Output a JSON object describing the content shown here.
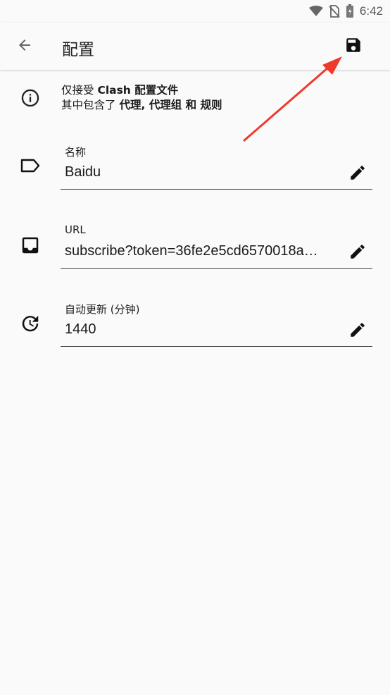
{
  "status_bar": {
    "time": "6:42",
    "icons": [
      "wifi-icon",
      "no-sim-icon",
      "battery-icon"
    ]
  },
  "app_bar": {
    "title": "配置",
    "back_icon": "arrow-back-icon",
    "save_icon": "save-icon"
  },
  "info": {
    "line1_prefix": "仅接受 ",
    "line1_bold": "Clash 配置文件",
    "line2_prefix": "其中包含了 ",
    "line2_bold": "代理, 代理组 和 规则"
  },
  "fields": [
    {
      "label": "名称",
      "value": "Baidu",
      "icon": "label-tag-icon"
    },
    {
      "label": "URL",
      "value": "subscribe?token=36fe2e5cd6570018a…",
      "icon": "inbox-icon"
    },
    {
      "label": "自动更新 (分钟)",
      "value": "1440",
      "icon": "update-clock-icon"
    }
  ],
  "annotation": {
    "color": "#ee3a2c"
  }
}
